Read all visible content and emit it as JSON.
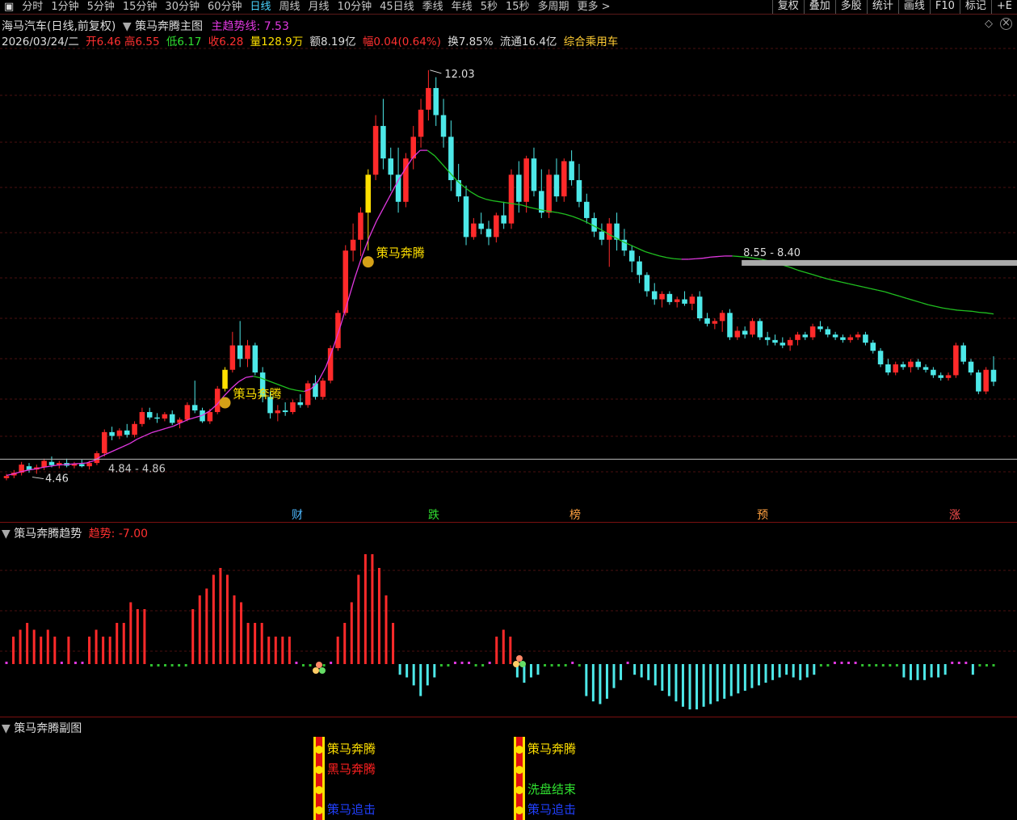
{
  "toolbar": {
    "menu_icon": "square-icon",
    "periods": [
      "分时",
      "1分钟",
      "5分钟",
      "15分钟",
      "30分钟",
      "60分钟",
      "日线",
      "周线",
      "月线",
      "10分钟",
      "45日线",
      "季线",
      "年线",
      "5秒",
      "15秒",
      "多周期",
      "更多 >"
    ],
    "active_period": "日线",
    "right": [
      "复权",
      "叠加",
      "多股",
      "统计",
      "画线",
      "F10",
      "标记",
      "+E"
    ]
  },
  "main": {
    "stock_name": "海马汽车(日线,前复权)",
    "indicator_name": "策马奔腾主图",
    "trend_label": "主趋势线:",
    "trend_value": "7.53",
    "date": "2026/03/24/二",
    "open_label": "开",
    "open": "6.46",
    "high_label": "高",
    "high": "6.55",
    "low_label": "低",
    "low": "6.17",
    "close_label": "收",
    "close": "6.28",
    "vol_label": "量",
    "vol": "128.9万",
    "amt_label": "额",
    "amt": "8.19亿",
    "chg_label": "幅",
    "chg": "0.04(0.64%)",
    "turn_label": "换",
    "turn": "7.85%",
    "float_label": "流通",
    "float": "16.4亿",
    "sector": "综合乘用车",
    "peak_label": "12.03",
    "low_price_label": "4.46",
    "support_label": "4.84 - 4.86",
    "resist_label": "8.55 - 8.40",
    "signal_label": "策马奔腾",
    "markers": [
      "财",
      "跌",
      "榜",
      "预",
      "涨"
    ],
    "colors": {
      "up": "#ff2a2a",
      "down": "#4de8e8",
      "trend_up": "#e038e0",
      "trend_down": "#20c020",
      "signal": "#ffe000"
    }
  },
  "trend_panel": {
    "title": "策马奔腾趋势",
    "value_label": "趋势:",
    "value": "-7.00"
  },
  "sub_panel": {
    "title": "策马奔腾副图",
    "signals_a": [
      "策马奔腾",
      "黑马奔腾",
      "策马追击"
    ],
    "signals_b": [
      "策马奔腾",
      "洗盘结束",
      "策马追击"
    ]
  },
  "chart_data": {
    "type": "candlestick",
    "y_range": [
      4.2,
      12.4
    ],
    "candles": [
      {
        "o": 4.5,
        "h": 4.58,
        "l": 4.46,
        "c": 4.54
      },
      {
        "o": 4.55,
        "h": 4.65,
        "l": 4.5,
        "c": 4.6
      },
      {
        "o": 4.6,
        "h": 4.8,
        "l": 4.55,
        "c": 4.75
      },
      {
        "o": 4.72,
        "h": 4.78,
        "l": 4.6,
        "c": 4.65
      },
      {
        "o": 4.66,
        "h": 4.75,
        "l": 4.58,
        "c": 4.7
      },
      {
        "o": 4.7,
        "h": 4.86,
        "l": 4.65,
        "c": 4.82
      },
      {
        "o": 4.8,
        "h": 4.9,
        "l": 4.7,
        "c": 4.74
      },
      {
        "o": 4.74,
        "h": 4.82,
        "l": 4.68,
        "c": 4.78
      },
      {
        "o": 4.78,
        "h": 4.86,
        "l": 4.7,
        "c": 4.73
      },
      {
        "o": 4.73,
        "h": 4.8,
        "l": 4.68,
        "c": 4.76
      },
      {
        "o": 4.76,
        "h": 4.84,
        "l": 4.7,
        "c": 4.72
      },
      {
        "o": 4.72,
        "h": 4.82,
        "l": 4.66,
        "c": 4.78
      },
      {
        "o": 4.78,
        "h": 5.0,
        "l": 4.74,
        "c": 4.96
      },
      {
        "o": 4.96,
        "h": 5.4,
        "l": 4.9,
        "c": 5.35
      },
      {
        "o": 5.35,
        "h": 5.45,
        "l": 5.2,
        "c": 5.28
      },
      {
        "o": 5.28,
        "h": 5.42,
        "l": 5.22,
        "c": 5.38
      },
      {
        "o": 5.38,
        "h": 5.5,
        "l": 5.25,
        "c": 5.3
      },
      {
        "o": 5.3,
        "h": 5.55,
        "l": 5.25,
        "c": 5.5
      },
      {
        "o": 5.5,
        "h": 5.8,
        "l": 5.45,
        "c": 5.72
      },
      {
        "o": 5.72,
        "h": 5.8,
        "l": 5.58,
        "c": 5.62
      },
      {
        "o": 5.62,
        "h": 5.7,
        "l": 5.52,
        "c": 5.6
      },
      {
        "o": 5.6,
        "h": 5.72,
        "l": 5.55,
        "c": 5.68
      },
      {
        "o": 5.68,
        "h": 5.75,
        "l": 5.48,
        "c": 5.52
      },
      {
        "o": 5.52,
        "h": 5.62,
        "l": 5.42,
        "c": 5.58
      },
      {
        "o": 5.58,
        "h": 5.9,
        "l": 5.55,
        "c": 5.85
      },
      {
        "o": 5.85,
        "h": 6.3,
        "l": 5.7,
        "c": 5.75
      },
      {
        "o": 5.75,
        "h": 5.8,
        "l": 5.52,
        "c": 5.55
      },
      {
        "o": 5.55,
        "h": 5.78,
        "l": 5.5,
        "c": 5.72
      },
      {
        "o": 5.72,
        "h": 6.2,
        "l": 5.68,
        "c": 6.15
      },
      {
        "o": 6.15,
        "h": 6.55,
        "l": 6.1,
        "c": 6.5
      },
      {
        "o": 6.5,
        "h": 7.2,
        "l": 6.45,
        "c": 6.95
      },
      {
        "o": 6.95,
        "h": 7.4,
        "l": 6.55,
        "c": 6.7
      },
      {
        "o": 6.7,
        "h": 7.05,
        "l": 6.55,
        "c": 6.95
      },
      {
        "o": 6.95,
        "h": 7.0,
        "l": 6.4,
        "c": 6.45
      },
      {
        "o": 6.45,
        "h": 6.55,
        "l": 5.9,
        "c": 6.0
      },
      {
        "o": 6.0,
        "h": 6.1,
        "l": 5.6,
        "c": 5.7
      },
      {
        "o": 5.7,
        "h": 5.85,
        "l": 5.55,
        "c": 5.75
      },
      {
        "o": 5.75,
        "h": 5.9,
        "l": 5.65,
        "c": 5.72
      },
      {
        "o": 5.72,
        "h": 5.95,
        "l": 5.68,
        "c": 5.9
      },
      {
        "o": 5.9,
        "h": 6.05,
        "l": 5.8,
        "c": 5.85
      },
      {
        "o": 5.85,
        "h": 6.3,
        "l": 5.8,
        "c": 6.25
      },
      {
        "o": 6.25,
        "h": 6.4,
        "l": 5.95,
        "c": 6.0
      },
      {
        "o": 6.0,
        "h": 6.35,
        "l": 5.95,
        "c": 6.3
      },
      {
        "o": 6.3,
        "h": 6.95,
        "l": 6.25,
        "c": 6.9
      },
      {
        "o": 6.9,
        "h": 7.6,
        "l": 6.85,
        "c": 7.55
      },
      {
        "o": 7.55,
        "h": 8.8,
        "l": 7.5,
        "c": 8.7
      },
      {
        "o": 8.7,
        "h": 9.2,
        "l": 8.5,
        "c": 8.9
      },
      {
        "o": 8.9,
        "h": 9.5,
        "l": 8.6,
        "c": 9.4
      },
      {
        "o": 9.4,
        "h": 10.2,
        "l": 8.7,
        "c": 10.1
      },
      {
        "o": 10.1,
        "h": 11.2,
        "l": 10.0,
        "c": 11.0
      },
      {
        "o": 11.0,
        "h": 11.5,
        "l": 10.2,
        "c": 10.4
      },
      {
        "o": 10.4,
        "h": 10.6,
        "l": 9.8,
        "c": 10.1
      },
      {
        "o": 10.1,
        "h": 10.6,
        "l": 9.4,
        "c": 9.6
      },
      {
        "o": 9.6,
        "h": 10.5,
        "l": 9.5,
        "c": 10.4
      },
      {
        "o": 10.4,
        "h": 11.0,
        "l": 10.2,
        "c": 10.8
      },
      {
        "o": 10.8,
        "h": 11.5,
        "l": 10.6,
        "c": 11.3
      },
      {
        "o": 11.3,
        "h": 12.03,
        "l": 11.1,
        "c": 11.7
      },
      {
        "o": 11.7,
        "h": 11.9,
        "l": 11.0,
        "c": 11.2
      },
      {
        "o": 11.2,
        "h": 11.5,
        "l": 10.6,
        "c": 10.8
      },
      {
        "o": 10.8,
        "h": 11.1,
        "l": 9.8,
        "c": 10.0
      },
      {
        "o": 10.0,
        "h": 10.3,
        "l": 9.6,
        "c": 9.7
      },
      {
        "o": 9.7,
        "h": 9.9,
        "l": 8.8,
        "c": 8.95
      },
      {
        "o": 8.95,
        "h": 9.3,
        "l": 8.9,
        "c": 9.2
      },
      {
        "o": 9.2,
        "h": 9.4,
        "l": 9.0,
        "c": 9.1
      },
      {
        "o": 9.1,
        "h": 9.25,
        "l": 8.8,
        "c": 8.95
      },
      {
        "o": 8.95,
        "h": 9.4,
        "l": 8.85,
        "c": 9.35
      },
      {
        "o": 9.35,
        "h": 9.6,
        "l": 9.1,
        "c": 9.2
      },
      {
        "o": 9.2,
        "h": 10.2,
        "l": 9.1,
        "c": 10.1
      },
      {
        "o": 10.1,
        "h": 10.35,
        "l": 9.4,
        "c": 9.6
      },
      {
        "o": 9.6,
        "h": 10.45,
        "l": 9.4,
        "c": 10.4
      },
      {
        "o": 10.4,
        "h": 10.6,
        "l": 9.7,
        "c": 9.8
      },
      {
        "o": 9.8,
        "h": 10.2,
        "l": 9.3,
        "c": 9.4
      },
      {
        "o": 9.4,
        "h": 10.2,
        "l": 9.3,
        "c": 10.1
      },
      {
        "o": 10.1,
        "h": 10.4,
        "l": 9.6,
        "c": 9.7
      },
      {
        "o": 9.7,
        "h": 10.4,
        "l": 9.6,
        "c": 10.35
      },
      {
        "o": 10.35,
        "h": 10.55,
        "l": 9.9,
        "c": 10.0
      },
      {
        "o": 10.0,
        "h": 10.3,
        "l": 9.5,
        "c": 9.6
      },
      {
        "o": 9.6,
        "h": 9.75,
        "l": 9.2,
        "c": 9.3
      },
      {
        "o": 9.3,
        "h": 9.4,
        "l": 8.95,
        "c": 9.05
      },
      {
        "o": 9.05,
        "h": 9.2,
        "l": 8.8,
        "c": 8.9
      },
      {
        "o": 8.9,
        "h": 9.3,
        "l": 8.4,
        "c": 9.2
      },
      {
        "o": 9.2,
        "h": 9.4,
        "l": 8.7,
        "c": 8.9
      },
      {
        "o": 8.9,
        "h": 9.1,
        "l": 8.6,
        "c": 8.7
      },
      {
        "o": 8.7,
        "h": 8.8,
        "l": 8.3,
        "c": 8.5
      },
      {
        "o": 8.5,
        "h": 8.6,
        "l": 8.1,
        "c": 8.25
      },
      {
        "o": 8.25,
        "h": 8.3,
        "l": 7.85,
        "c": 7.95
      },
      {
        "o": 7.95,
        "h": 8.1,
        "l": 7.7,
        "c": 7.8
      },
      {
        "o": 7.8,
        "h": 7.95,
        "l": 7.65,
        "c": 7.9
      },
      {
        "o": 7.9,
        "h": 7.95,
        "l": 7.7,
        "c": 7.75
      },
      {
        "o": 7.75,
        "h": 7.85,
        "l": 7.65,
        "c": 7.8
      },
      {
        "o": 7.8,
        "h": 7.95,
        "l": 7.68,
        "c": 7.72
      },
      {
        "o": 7.72,
        "h": 7.9,
        "l": 7.6,
        "c": 7.85
      },
      {
        "o": 7.85,
        "h": 7.95,
        "l": 7.4,
        "c": 7.45
      },
      {
        "o": 7.45,
        "h": 7.55,
        "l": 7.3,
        "c": 7.35
      },
      {
        "o": 7.35,
        "h": 7.45,
        "l": 7.25,
        "c": 7.4
      },
      {
        "o": 7.4,
        "h": 7.6,
        "l": 7.2,
        "c": 7.55
      },
      {
        "o": 7.55,
        "h": 7.62,
        "l": 7.05,
        "c": 7.1
      },
      {
        "o": 7.1,
        "h": 7.3,
        "l": 7.05,
        "c": 7.22
      },
      {
        "o": 7.22,
        "h": 7.3,
        "l": 7.08,
        "c": 7.15
      },
      {
        "o": 7.15,
        "h": 7.45,
        "l": 7.1,
        "c": 7.4
      },
      {
        "o": 7.4,
        "h": 7.45,
        "l": 7.05,
        "c": 7.1
      },
      {
        "o": 7.1,
        "h": 7.2,
        "l": 6.95,
        "c": 7.05
      },
      {
        "o": 7.05,
        "h": 7.15,
        "l": 6.95,
        "c": 7.0
      },
      {
        "o": 7.0,
        "h": 7.1,
        "l": 6.9,
        "c": 6.95
      },
      {
        "o": 6.95,
        "h": 7.1,
        "l": 6.85,
        "c": 7.05
      },
      {
        "o": 7.05,
        "h": 7.2,
        "l": 6.95,
        "c": 7.15
      },
      {
        "o": 7.15,
        "h": 7.2,
        "l": 7.05,
        "c": 7.1
      },
      {
        "o": 7.1,
        "h": 7.35,
        "l": 7.05,
        "c": 7.3
      },
      {
        "o": 7.3,
        "h": 7.4,
        "l": 7.2,
        "c": 7.25
      },
      {
        "o": 7.25,
        "h": 7.3,
        "l": 7.1,
        "c": 7.15
      },
      {
        "o": 7.15,
        "h": 7.2,
        "l": 7.05,
        "c": 7.1
      },
      {
        "o": 7.1,
        "h": 7.15,
        "l": 7.0,
        "c": 7.05
      },
      {
        "o": 7.05,
        "h": 7.15,
        "l": 7.0,
        "c": 7.1
      },
      {
        "o": 7.1,
        "h": 7.2,
        "l": 7.05,
        "c": 7.15
      },
      {
        "o": 7.15,
        "h": 7.2,
        "l": 6.95,
        "c": 7.0
      },
      {
        "o": 7.0,
        "h": 7.05,
        "l": 6.8,
        "c": 6.85
      },
      {
        "o": 6.85,
        "h": 6.9,
        "l": 6.55,
        "c": 6.6
      },
      {
        "o": 6.6,
        "h": 6.7,
        "l": 6.4,
        "c": 6.45
      },
      {
        "o": 6.45,
        "h": 6.65,
        "l": 6.4,
        "c": 6.6
      },
      {
        "o": 6.6,
        "h": 6.65,
        "l": 6.5,
        "c": 6.55
      },
      {
        "o": 6.55,
        "h": 6.7,
        "l": 6.45,
        "c": 6.65
      },
      {
        "o": 6.65,
        "h": 6.7,
        "l": 6.5,
        "c": 6.55
      },
      {
        "o": 6.55,
        "h": 6.6,
        "l": 6.45,
        "c": 6.5
      },
      {
        "o": 6.5,
        "h": 6.55,
        "l": 6.35,
        "c": 6.4
      },
      {
        "o": 6.4,
        "h": 6.45,
        "l": 6.3,
        "c": 6.35
      },
      {
        "o": 6.35,
        "h": 6.45,
        "l": 6.3,
        "c": 6.4
      },
      {
        "o": 6.4,
        "h": 7.0,
        "l": 6.35,
        "c": 6.95
      },
      {
        "o": 6.95,
        "h": 7.0,
        "l": 6.6,
        "c": 6.65
      },
      {
        "o": 6.65,
        "h": 6.7,
        "l": 6.4,
        "c": 6.45
      },
      {
        "o": 6.45,
        "h": 6.5,
        "l": 6.05,
        "c": 6.1
      },
      {
        "o": 6.1,
        "h": 6.55,
        "l": 6.05,
        "c": 6.5
      },
      {
        "o": 6.5,
        "h": 6.75,
        "l": 6.2,
        "c": 6.28
      }
    ],
    "trend_line": [
      4.55,
      4.58,
      4.62,
      4.65,
      4.67,
      4.7,
      4.72,
      4.74,
      4.75,
      4.76,
      4.77,
      4.78,
      4.82,
      4.9,
      4.96,
      5.02,
      5.08,
      5.14,
      5.22,
      5.28,
      5.34,
      5.38,
      5.42,
      5.46,
      5.52,
      5.58,
      5.62,
      5.66,
      5.74,
      5.86,
      6.02,
      6.16,
      6.28,
      6.36,
      6.38,
      6.35,
      6.3,
      6.25,
      6.2,
      6.15,
      6.12,
      6.1,
      6.15,
      6.3,
      6.55,
      6.9,
      7.3,
      7.75,
      8.2,
      8.6,
      8.95,
      9.25,
      9.5,
      9.75,
      10.0,
      10.22,
      10.42,
      10.55,
      10.55,
      10.45,
      10.3,
      10.15,
      10.0,
      9.88,
      9.78,
      9.7,
      9.65,
      9.62,
      9.6,
      9.58,
      9.56,
      9.54,
      9.5,
      9.47,
      9.44,
      9.42,
      9.4,
      9.37,
      9.33,
      9.28,
      9.22,
      9.15,
      9.08,
      9.0,
      8.93,
      8.86,
      8.8,
      8.74,
      8.68,
      8.64,
      8.6,
      8.57,
      8.55,
      8.54,
      8.54,
      8.55,
      8.56,
      8.58,
      8.59,
      8.6,
      8.6,
      8.59,
      8.58,
      8.56,
      8.54,
      8.51,
      8.47,
      8.43,
      8.39,
      8.34,
      8.3,
      8.26,
      8.22,
      8.18,
      8.15,
      8.12,
      8.09,
      8.06,
      8.03,
      8.0,
      7.97,
      7.94,
      7.9,
      7.86,
      7.82,
      7.78,
      7.74,
      7.7,
      7.67,
      7.64,
      7.62,
      7.6,
      7.59,
      7.58,
      7.56,
      7.55,
      7.53
    ],
    "signal_candles": [
      29,
      48
    ],
    "trend_bars": [
      1,
      1,
      1,
      1,
      1,
      1,
      1,
      1,
      1,
      1,
      1,
      1,
      -0.5,
      -0.5,
      -0.5,
      -0.5,
      -0.5,
      -0.5,
      -0.5,
      -0.5,
      -0.5,
      -0.5,
      -0.5,
      -0.5,
      -0.5,
      -0.5,
      -0.5,
      -0.5,
      -0.5,
      -0.5,
      1,
      1,
      1,
      1,
      1,
      1,
      2,
      3,
      4,
      5,
      6,
      7,
      8,
      9,
      10,
      11,
      12,
      13,
      14,
      14,
      13,
      12,
      11,
      10,
      9,
      8,
      7,
      6,
      5,
      4,
      3,
      2,
      1,
      1,
      1,
      1,
      1,
      1,
      1,
      1,
      1,
      1,
      1,
      1,
      1,
      1,
      1,
      1,
      1,
      1,
      1,
      1,
      1,
      1,
      1,
      1,
      1,
      1
    ],
    "macd": [
      0.3,
      0.4,
      0.5,
      0.6,
      0.5,
      0.4,
      0.5,
      0.4,
      0.3,
      0.4,
      0.3,
      0.3,
      0.4,
      0.5,
      0.4,
      0.4,
      0.6,
      0.6,
      0.9,
      0.8,
      0.8,
      -0.3,
      -0.3,
      -0.3,
      -0.3,
      -0.3,
      -0.3,
      0.8,
      1.0,
      1.1,
      1.3,
      1.4,
      1.3,
      1.0,
      0.9,
      0.6,
      0.6,
      0.6,
      0.4,
      0.4,
      0.4,
      0.4,
      0.3,
      -0.3,
      -0.3,
      -0.3,
      -0.3,
      0.3,
      0.4,
      0.6,
      0.9,
      1.3,
      1.6,
      1.6,
      1.4,
      1.0,
      0.6,
      -0.4,
      -0.5,
      -0.8,
      -1.2,
      -0.8,
      -0.5,
      -0.3,
      -0.2,
      0.2,
      0.3,
      0.3,
      -0.3,
      -0.3,
      0.3,
      0.4,
      0.5,
      0.4,
      -0.5,
      -0.7,
      -0.5,
      -0.4,
      -0.3,
      -0.2,
      -0.3,
      -0.1,
      0.2,
      -0.3,
      -1.2,
      -1.4,
      -1.5,
      -1.3,
      -0.9,
      -0.6,
      0.2,
      -0.4,
      -0.5,
      -0.6,
      -0.8,
      -1.0,
      -1.2,
      -1.4,
      -1.6,
      -1.7,
      -1.7,
      -1.6,
      -1.5,
      -1.4,
      -1.3,
      -1.2,
      -1.1,
      -1.0,
      -0.9,
      -0.8,
      -0.7,
      -0.6,
      -0.5,
      -0.4,
      -0.5,
      -0.6,
      -0.5,
      -0.4,
      -0.3,
      -0.2,
      0.2,
      0.2,
      0.2,
      0.1,
      -0.1,
      -0.1,
      -0.1,
      -0.2,
      -0.2,
      -0.3,
      -0.5,
      -0.6,
      -0.6,
      -0.6,
      -0.5,
      -0.5,
      -0.4,
      0.2,
      0.2,
      0.2,
      -0.4,
      -0.3,
      -0.2,
      -0.2
    ]
  }
}
